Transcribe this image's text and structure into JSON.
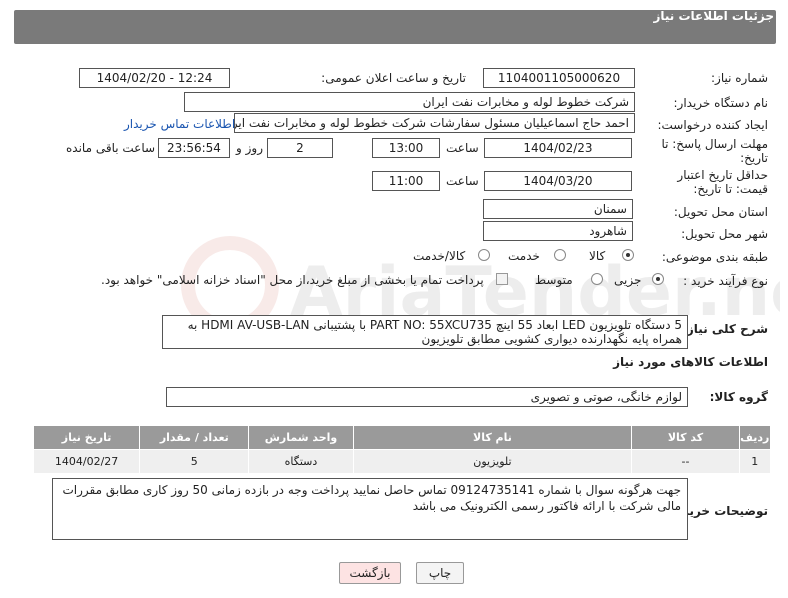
{
  "header": {
    "title": "جزئیات اطلاعات نیاز"
  },
  "form": {
    "need_number_label": "شماره نیاز:",
    "need_number": "1104001105000620",
    "announce_label": "تاریخ و ساعت اعلان عمومی:",
    "announce_value": "1404/02/20 - 12:24",
    "buyer_label": "نام دستگاه خریدار:",
    "buyer_value": "شرکت خطوط لوله و مخابرات نفت ایران",
    "creator_label": "ایجاد کننده درخواست:",
    "creator_value": "احمد  حاج اسماعیلیان مسئول سفارشات  شرکت خطوط لوله و مخابرات نفت ایر",
    "contact_link": "اطلاعات تماس خریدار",
    "deadline_label": "مهلت ارسال پاسخ: تا تاریخ:",
    "deadline_date": "1404/02/23",
    "time_label": "ساعت",
    "deadline_time": "13:00",
    "days_value": "2",
    "days_label": "روز و",
    "remaining_time": "23:56:54",
    "remaining_label": "ساعت باقی مانده",
    "validity_label": "حداقل تاریخ اعتبار قیمت: تا تاریخ:",
    "validity_date": "1404/03/20",
    "validity_time": "11:00",
    "province_label": "استان محل تحویل:",
    "province_value": "سمنان",
    "city_label": "شهر محل تحویل:",
    "city_value": "شاهرود",
    "category_label": "طبقه بندی موضوعی:",
    "category_options": [
      "کالا",
      "خدمت",
      "کالا/خدمت"
    ],
    "category_selected": "کالا",
    "process_label": "نوع فرآیند خرید :",
    "process_options": [
      "جزیی",
      "متوسط"
    ],
    "process_selected": "جزیی",
    "payment_note": "پرداخت تمام یا بخشی از مبلغ خرید،از محل \"اسناد خزانه اسلامی\" خواهد بود."
  },
  "description": {
    "label": "شرح کلی نیاز:",
    "text": "5 دستگاه تلویزیون LED ابعاد 55 اینچ PART NO: 55XCU735 با پشتیبانی HDMI AV-USB-LAN به همراه پایه نگهدارنده دیواری کشویی مطابق تلویزیون"
  },
  "goods": {
    "section_title": "اطلاعات کالاهای مورد نیاز",
    "group_label": "گروه کالا:",
    "group_value": "لوازم خانگی، صوتی و تصویری",
    "columns": [
      "ردیف",
      "کد کالا",
      "نام کالا",
      "واحد شمارش",
      "تعداد / مقدار",
      "تاریخ نیاز"
    ],
    "rows": [
      {
        "row": "1",
        "code": "--",
        "name": "تلویزیون",
        "unit": "دستگاه",
        "qty": "5",
        "date": "1404/02/27"
      }
    ]
  },
  "buyer_notes": {
    "label": "توضیحات خریدار:",
    "text": "جهت هرگونه سوال با شماره 09124735141 تماس حاصل نمایید پرداخت وجه در بازده زمانی 50 روز کاری مطابق مقررات مالی شرکت با ارائه فاکتور رسمی الکترونیک می باشد"
  },
  "buttons": {
    "print": "چاپ",
    "back": "بازگشت"
  },
  "watermark": {
    "text": "AriaTender.net"
  },
  "colors": {
    "header_bg": "#7a7a7a",
    "table_header_bg": "#9a9a9a",
    "link": "#1a55b0",
    "back_button_bg": "#fde3e3"
  }
}
